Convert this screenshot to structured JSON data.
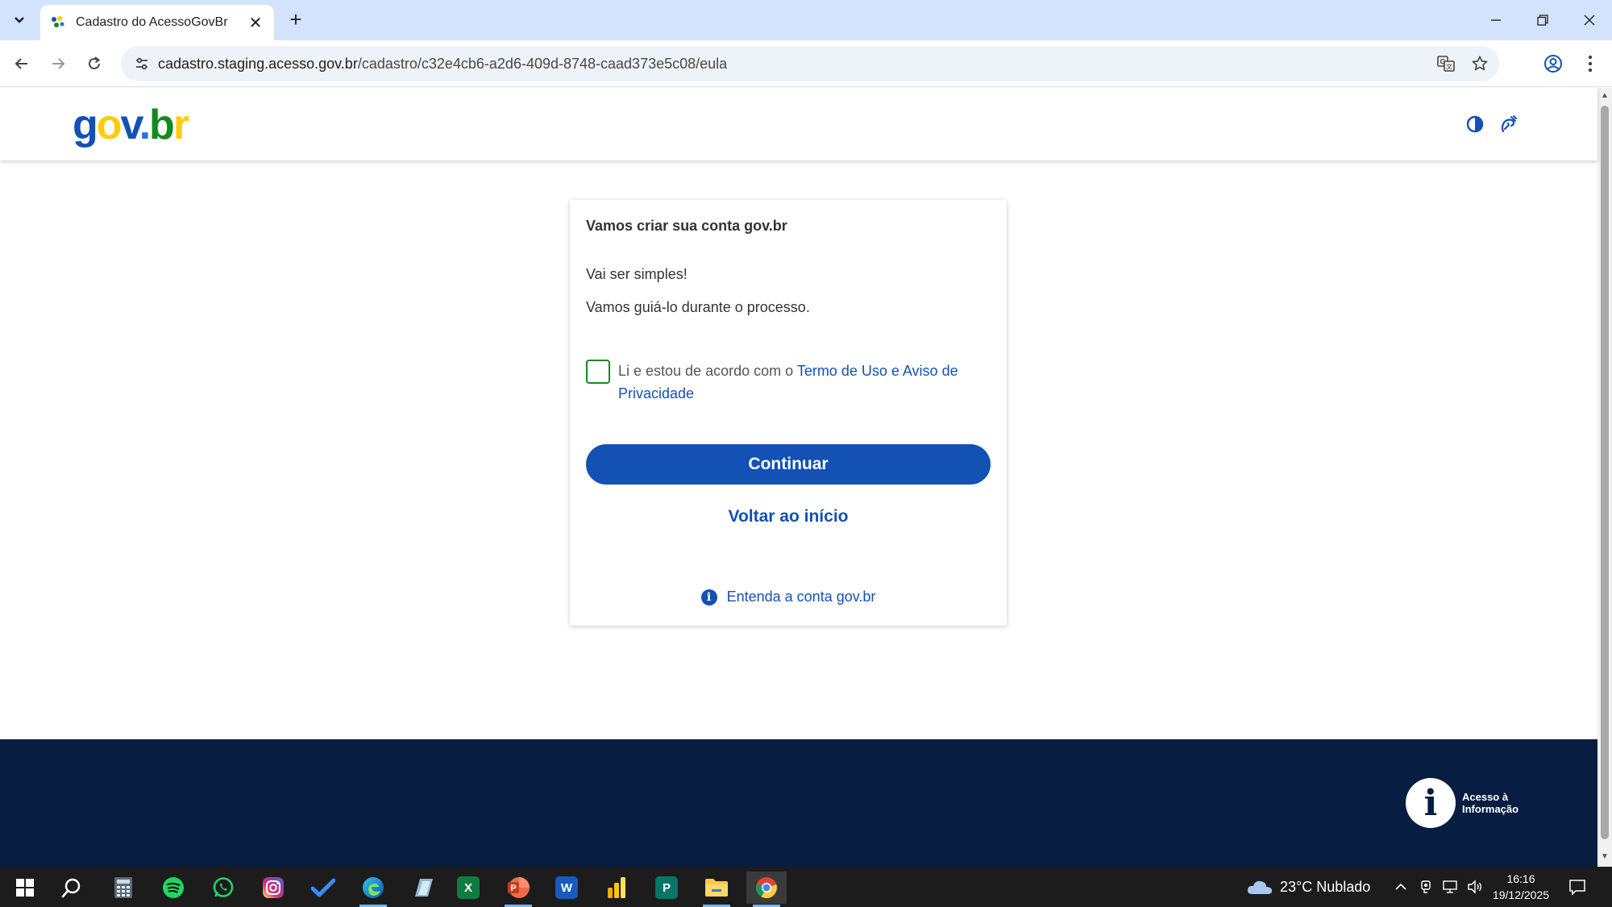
{
  "browser": {
    "tab_title": "Cadastro do AcessoGovBr",
    "url_host": "cadastro.staging.acesso.gov.br",
    "url_path": "/cadastro/c32e4cb6-a2d6-409d-8748-caad373e5c08/eula"
  },
  "header": {
    "logo": {
      "g": "g",
      "o": "o",
      "v": "v",
      "dot": ".",
      "b": "b",
      "r": "r"
    }
  },
  "card": {
    "title": "Vamos criar sua conta gov.br",
    "line1": "Vai ser simples!",
    "line2": "Vamos guiá-lo durante o processo.",
    "checkbox_prefix": "Li e estou de acordo com o ",
    "checkbox_link": "Termo de Uso e Aviso de Privacidade",
    "continue_label": "Continuar",
    "back_label": "Voltar ao início",
    "info_link": "Entenda a conta gov.br"
  },
  "footer": {
    "access_info_line1": "Acesso à",
    "access_info_line2": "Informação"
  },
  "taskbar": {
    "weather": "23°C  Nublado",
    "time": "16:16",
    "date": "19/12/2025"
  },
  "colors": {
    "brand_blue": "#1351b4",
    "footer_navy": "#071d41",
    "checkbox_green": "#168821",
    "logo_yellow": "#ffcd07"
  }
}
